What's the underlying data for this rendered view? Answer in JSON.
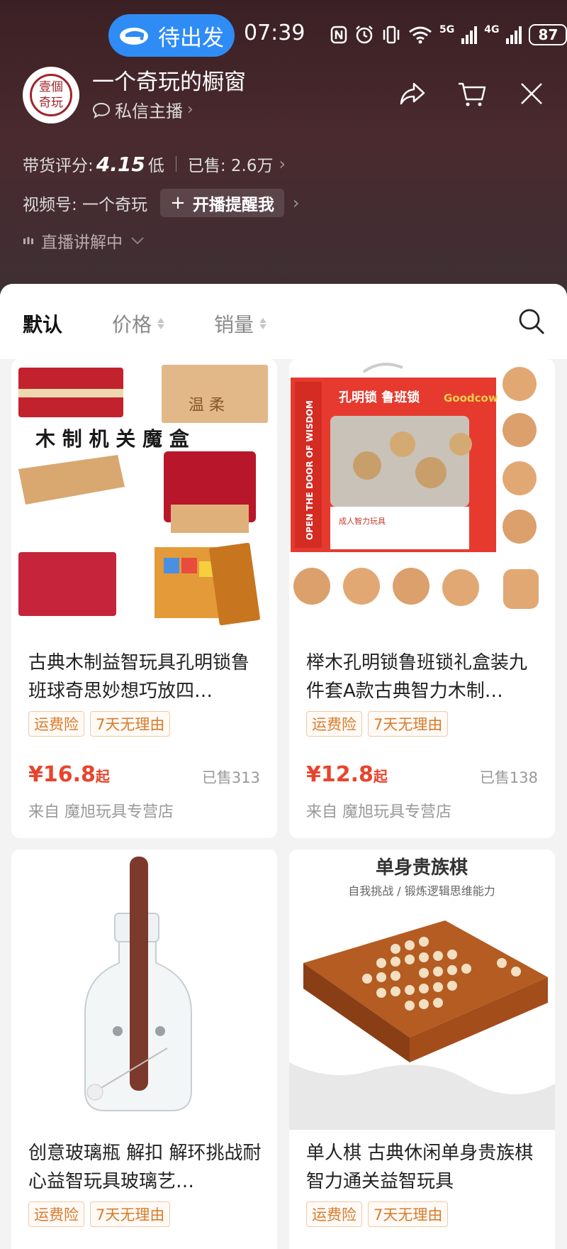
{
  "status_bar": {
    "pill_label": "待出发",
    "time": "07:39",
    "battery": "87",
    "net1": "5G",
    "net2": "4G"
  },
  "shop": {
    "logo_line1": "壹個",
    "logo_line2": "奇玩",
    "name": "一个奇玩的橱窗",
    "dm_label": "私信主播",
    "rating_label": "带货评分:",
    "rating_value": "4.15",
    "rating_level": "低",
    "sold_label": "已售: 2.6万",
    "channel_label": "视频号: 一个奇玩",
    "remind_label": "开播提醒我",
    "live_label": "直播讲解中"
  },
  "sort_bar": {
    "default": "默认",
    "price": "价格",
    "sales": "销量"
  },
  "products": [
    {
      "title": "古典木制益智玩具孔明锁鲁班球奇思妙想巧放四…",
      "tags": [
        "运费险",
        "7天无理由"
      ],
      "price": "¥16.8",
      "price_suffix": "起",
      "sold": "已售313",
      "from": "来自 魔旭玩具专营店",
      "img_caption": "木 制 机 关 魔 盒",
      "img_stamp": "温 柔"
    },
    {
      "title": "榉木孔明锁鲁班锁礼盒装九件套A款古典智力木制…",
      "tags": [
        "运费险",
        "7天无理由"
      ],
      "price": "¥12.8",
      "price_suffix": "起",
      "sold": "已售138",
      "from": "来自 魔旭玩具专营店",
      "img_box_title": "孔明锁 鲁班锁",
      "img_brand": "Goodcow",
      "img_side": "OPEN THE DOOR OF WISDOM",
      "img_box_caption": "成人智力玩具"
    },
    {
      "title": "创意玻璃瓶 解扣 解环挑战耐心益智玩具玻璃艺…",
      "tags": [
        "运费险",
        "7天无理由"
      ]
    },
    {
      "title": "单人棋  古典休闲单身贵族棋智力通关益智玩具",
      "tags": [
        "运费险",
        "7天无理由"
      ],
      "img_heading": "单身贵族棋",
      "img_sub": "自我挑战 / 锻炼逻辑思维能力"
    }
  ],
  "colors": {
    "header_bg": "#3a2024",
    "pill": "#2f8cf5",
    "price": "#e8442d",
    "tag": "#d97b2b"
  }
}
